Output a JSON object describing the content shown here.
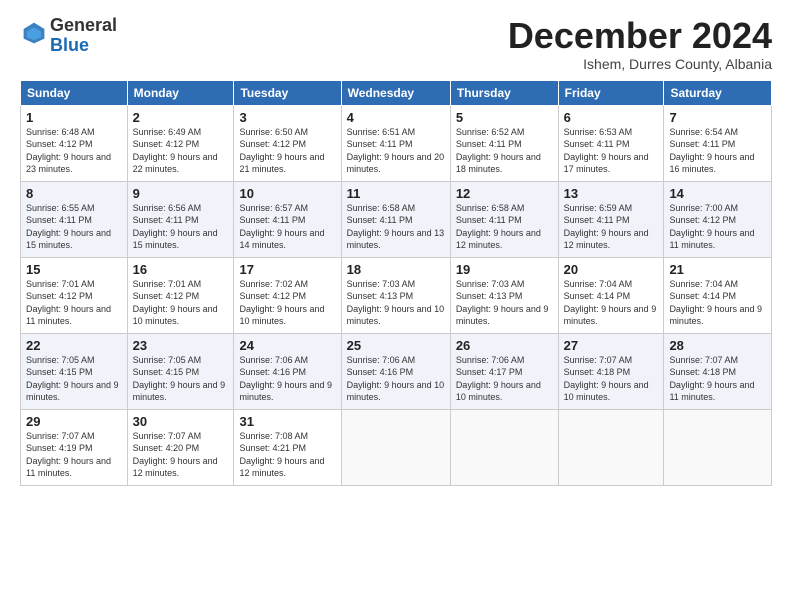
{
  "logo": {
    "general": "General",
    "blue": "Blue"
  },
  "title": "December 2024",
  "location": "Ishem, Durres County, Albania",
  "days_header": [
    "Sunday",
    "Monday",
    "Tuesday",
    "Wednesday",
    "Thursday",
    "Friday",
    "Saturday"
  ],
  "weeks": [
    [
      {
        "day": "1",
        "sunrise": "6:48 AM",
        "sunset": "4:12 PM",
        "daylight": "9 hours and 23 minutes."
      },
      {
        "day": "2",
        "sunrise": "6:49 AM",
        "sunset": "4:12 PM",
        "daylight": "9 hours and 22 minutes."
      },
      {
        "day": "3",
        "sunrise": "6:50 AM",
        "sunset": "4:12 PM",
        "daylight": "9 hours and 21 minutes."
      },
      {
        "day": "4",
        "sunrise": "6:51 AM",
        "sunset": "4:11 PM",
        "daylight": "9 hours and 20 minutes."
      },
      {
        "day": "5",
        "sunrise": "6:52 AM",
        "sunset": "4:11 PM",
        "daylight": "9 hours and 18 minutes."
      },
      {
        "day": "6",
        "sunrise": "6:53 AM",
        "sunset": "4:11 PM",
        "daylight": "9 hours and 17 minutes."
      },
      {
        "day": "7",
        "sunrise": "6:54 AM",
        "sunset": "4:11 PM",
        "daylight": "9 hours and 16 minutes."
      }
    ],
    [
      {
        "day": "8",
        "sunrise": "6:55 AM",
        "sunset": "4:11 PM",
        "daylight": "9 hours and 15 minutes."
      },
      {
        "day": "9",
        "sunrise": "6:56 AM",
        "sunset": "4:11 PM",
        "daylight": "9 hours and 15 minutes."
      },
      {
        "day": "10",
        "sunrise": "6:57 AM",
        "sunset": "4:11 PM",
        "daylight": "9 hours and 14 minutes."
      },
      {
        "day": "11",
        "sunrise": "6:58 AM",
        "sunset": "4:11 PM",
        "daylight": "9 hours and 13 minutes."
      },
      {
        "day": "12",
        "sunrise": "6:58 AM",
        "sunset": "4:11 PM",
        "daylight": "9 hours and 12 minutes."
      },
      {
        "day": "13",
        "sunrise": "6:59 AM",
        "sunset": "4:11 PM",
        "daylight": "9 hours and 12 minutes."
      },
      {
        "day": "14",
        "sunrise": "7:00 AM",
        "sunset": "4:12 PM",
        "daylight": "9 hours and 11 minutes."
      }
    ],
    [
      {
        "day": "15",
        "sunrise": "7:01 AM",
        "sunset": "4:12 PM",
        "daylight": "9 hours and 11 minutes."
      },
      {
        "day": "16",
        "sunrise": "7:01 AM",
        "sunset": "4:12 PM",
        "daylight": "9 hours and 10 minutes."
      },
      {
        "day": "17",
        "sunrise": "7:02 AM",
        "sunset": "4:12 PM",
        "daylight": "9 hours and 10 minutes."
      },
      {
        "day": "18",
        "sunrise": "7:03 AM",
        "sunset": "4:13 PM",
        "daylight": "9 hours and 10 minutes."
      },
      {
        "day": "19",
        "sunrise": "7:03 AM",
        "sunset": "4:13 PM",
        "daylight": "9 hours and 9 minutes."
      },
      {
        "day": "20",
        "sunrise": "7:04 AM",
        "sunset": "4:14 PM",
        "daylight": "9 hours and 9 minutes."
      },
      {
        "day": "21",
        "sunrise": "7:04 AM",
        "sunset": "4:14 PM",
        "daylight": "9 hours and 9 minutes."
      }
    ],
    [
      {
        "day": "22",
        "sunrise": "7:05 AM",
        "sunset": "4:15 PM",
        "daylight": "9 hours and 9 minutes."
      },
      {
        "day": "23",
        "sunrise": "7:05 AM",
        "sunset": "4:15 PM",
        "daylight": "9 hours and 9 minutes."
      },
      {
        "day": "24",
        "sunrise": "7:06 AM",
        "sunset": "4:16 PM",
        "daylight": "9 hours and 9 minutes."
      },
      {
        "day": "25",
        "sunrise": "7:06 AM",
        "sunset": "4:16 PM",
        "daylight": "9 hours and 10 minutes."
      },
      {
        "day": "26",
        "sunrise": "7:06 AM",
        "sunset": "4:17 PM",
        "daylight": "9 hours and 10 minutes."
      },
      {
        "day": "27",
        "sunrise": "7:07 AM",
        "sunset": "4:18 PM",
        "daylight": "9 hours and 10 minutes."
      },
      {
        "day": "28",
        "sunrise": "7:07 AM",
        "sunset": "4:18 PM",
        "daylight": "9 hours and 11 minutes."
      }
    ],
    [
      {
        "day": "29",
        "sunrise": "7:07 AM",
        "sunset": "4:19 PM",
        "daylight": "9 hours and 11 minutes."
      },
      {
        "day": "30",
        "sunrise": "7:07 AM",
        "sunset": "4:20 PM",
        "daylight": "9 hours and 12 minutes."
      },
      {
        "day": "31",
        "sunrise": "7:08 AM",
        "sunset": "4:21 PM",
        "daylight": "9 hours and 12 minutes."
      },
      null,
      null,
      null,
      null
    ]
  ]
}
